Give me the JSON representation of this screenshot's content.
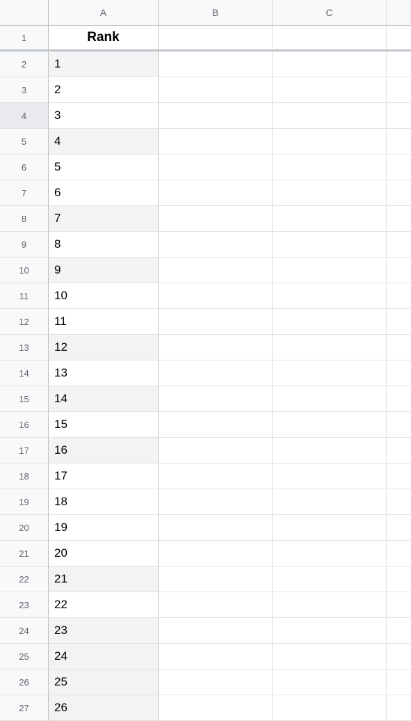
{
  "columns": [
    "A",
    "B",
    "C",
    ""
  ],
  "header": {
    "A": "Rank",
    "B": "",
    "C": "",
    "D": ""
  },
  "rows": [
    {
      "num": 1,
      "A": "",
      "shaded": false,
      "isHeader": true
    },
    {
      "num": 2,
      "A": "1",
      "shaded": true
    },
    {
      "num": 3,
      "A": "2",
      "shaded": false
    },
    {
      "num": 4,
      "A": "3",
      "shaded": false,
      "rowHover": true
    },
    {
      "num": 5,
      "A": "4",
      "shaded": true
    },
    {
      "num": 6,
      "A": "5",
      "shaded": false
    },
    {
      "num": 7,
      "A": "6",
      "shaded": false
    },
    {
      "num": 8,
      "A": "7",
      "shaded": true
    },
    {
      "num": 9,
      "A": "8",
      "shaded": false
    },
    {
      "num": 10,
      "A": "9",
      "shaded": true
    },
    {
      "num": 11,
      "A": "10",
      "shaded": false
    },
    {
      "num": 12,
      "A": "11",
      "shaded": false
    },
    {
      "num": 13,
      "A": "12",
      "shaded": true
    },
    {
      "num": 14,
      "A": "13",
      "shaded": false
    },
    {
      "num": 15,
      "A": "14",
      "shaded": true
    },
    {
      "num": 16,
      "A": "15",
      "shaded": false
    },
    {
      "num": 17,
      "A": "16",
      "shaded": true
    },
    {
      "num": 18,
      "A": "17",
      "shaded": false
    },
    {
      "num": 19,
      "A": "18",
      "shaded": false
    },
    {
      "num": 20,
      "A": "19",
      "shaded": false
    },
    {
      "num": 21,
      "A": "20",
      "shaded": false
    },
    {
      "num": 22,
      "A": "21",
      "shaded": true
    },
    {
      "num": 23,
      "A": "22",
      "shaded": false
    },
    {
      "num": 24,
      "A": "23",
      "shaded": true
    },
    {
      "num": 25,
      "A": "24",
      "shaded": true
    },
    {
      "num": 26,
      "A": "25",
      "shaded": true
    },
    {
      "num": 27,
      "A": "26",
      "shaded": true
    }
  ]
}
